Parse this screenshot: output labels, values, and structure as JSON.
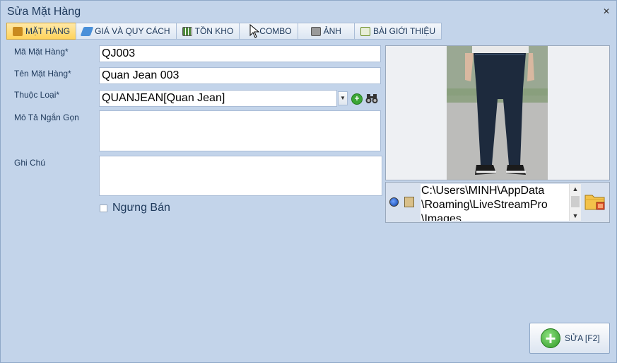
{
  "window": {
    "title": "Sửa Mặt Hàng",
    "close_glyph": "✕"
  },
  "tabs": [
    {
      "label": "MẶT HÀNG",
      "icon": "box-icon",
      "color": "#c98a1e",
      "active": true
    },
    {
      "label": "GIÁ VÀ QUY CÁCH",
      "icon": "tag-icon",
      "color": "#4a90d9",
      "active": false
    },
    {
      "label": "TỒN KHO",
      "icon": "grid-icon",
      "color": "#4f8a3c",
      "active": false
    },
    {
      "label": "COMBO",
      "icon": "cursor-icon",
      "color": "#333333",
      "active": false
    },
    {
      "label": "ẢNH",
      "icon": "printer-icon",
      "color": "#6b6b6b",
      "active": false
    },
    {
      "label": "BÀI GIỚI THIỆU",
      "icon": "document-icon",
      "color": "#6b8e23",
      "active": false
    }
  ],
  "form": {
    "code_label": "Mã Mặt Hàng*",
    "code_value": "QJ003",
    "name_label": "Tên Mặt Hàng*",
    "name_value": "Quan Jean 003",
    "category_label": "Thuộc Loại*",
    "category_value": "QUANJEAN[Quan Jean]",
    "short_desc_label": "Mô Tả Ngắn Gọn",
    "short_desc_value": "",
    "note_label": "Ghi Chú",
    "note_value": "",
    "stop_selling_label": "Ngưng Bán",
    "stop_selling_checked": false
  },
  "image": {
    "path_text": "C:\\Users\\MINH\\AppData\n\\Roaming\\LiveStreamPro\n\\Images"
  },
  "save_button": {
    "label": "SỬA [F2]"
  }
}
